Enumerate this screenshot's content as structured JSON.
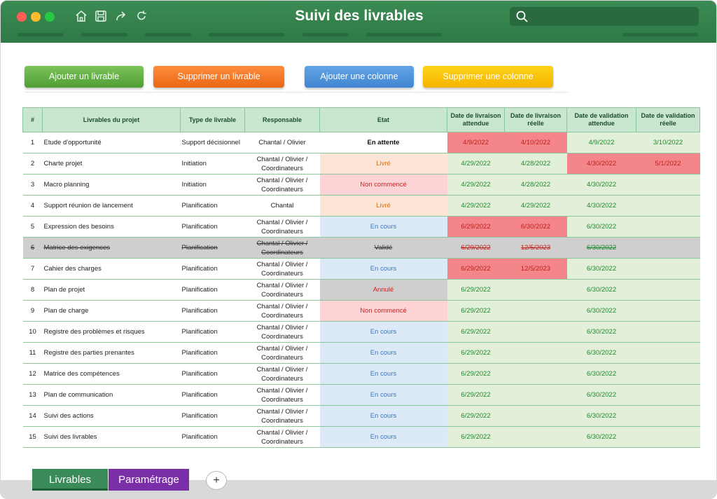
{
  "window": {
    "title": "Suivi des livrables",
    "search_placeholder": ""
  },
  "toolbar": {
    "add_label": "Ajouter un livrable",
    "delete_label": "Supprimer un livrable",
    "add_column_label": "Ajouter une colonne",
    "delete_column_label": "Supprimer une colonne"
  },
  "table": {
    "headers": [
      "#",
      "Livrables du projet",
      "Type de livrable",
      "Responsable",
      "Etat",
      "Date de livraison attendue",
      "Date de livraison réelle",
      "Date de validation attendue",
      "Date de validation réelle"
    ],
    "rows": [
      {
        "n": "1",
        "name": "Etude d'opportunité",
        "type": "Support décisionnel",
        "resp": "Chantal / Olivier",
        "state": "En attente",
        "d1": "4/9/2022",
        "d2": "4/10/2022",
        "d3": "4/9/2022",
        "d4": "3/10/2022"
      },
      {
        "n": "2",
        "name": "Charte projet",
        "type": "Initiation",
        "resp": "Chantal / Olivier / Coordinateurs",
        "state": "Livré",
        "d1": "4/29/2022",
        "d2": "4/28/2022",
        "d3": "4/30/2022",
        "d4": "5/1/2022"
      },
      {
        "n": "3",
        "name": "Macro planning",
        "type": "Initiation",
        "resp": "Chantal / Olivier / Coordinateurs",
        "state": "Non commencé",
        "d1": "4/29/2022",
        "d2": "4/28/2022",
        "d3": "4/30/2022",
        "d4": ""
      },
      {
        "n": "4",
        "name": "Support réunion de lancement",
        "type": "Planification",
        "resp": "Chantal",
        "state": "Livré",
        "d1": "4/29/2022",
        "d2": "4/29/2022",
        "d3": "4/30/2022",
        "d4": ""
      },
      {
        "n": "5",
        "name": "Expression des besoins",
        "type": "Planification",
        "resp": "Chantal / Olivier / Coordinateurs",
        "state": "En cours",
        "d1": "6/29/2022",
        "d2": "6/30/2022",
        "d3": "6/30/2022",
        "d4": ""
      },
      {
        "n": "6",
        "name": "Matrice des exigences",
        "type": "Planification",
        "resp": "Chantal / Olivier / Coordinateurs",
        "state": "Validé",
        "d1": "6/29/2022",
        "d2": "12/5/2023",
        "d3": "6/30/2022",
        "d4": ""
      },
      {
        "n": "7",
        "name": "Cahier des charges",
        "type": "Planification",
        "resp": "Chantal / Olivier / Coordinateurs",
        "state": "En cours",
        "d1": "6/29/2022",
        "d2": "12/5/2023",
        "d3": "6/30/2022",
        "d4": ""
      },
      {
        "n": "8",
        "name": "Plan de projet",
        "type": "Planification",
        "resp": "Chantal / Olivier / Coordinateurs",
        "state": "Annulé",
        "d1": "6/29/2022",
        "d2": "",
        "d3": "6/30/2022",
        "d4": ""
      },
      {
        "n": "9",
        "name": "Plan de charge",
        "type": "Planification",
        "resp": "Chantal / Olivier / Coordinateurs",
        "state": "Non commencé",
        "d1": "6/29/2022",
        "d2": "",
        "d3": "6/30/2022",
        "d4": ""
      },
      {
        "n": "10",
        "name": "Registre des problèmes et risques",
        "type": "Planification",
        "resp": "Chantal / Olivier / Coordinateurs",
        "state": "En cours",
        "d1": "6/29/2022",
        "d2": "",
        "d3": "6/30/2022",
        "d4": ""
      },
      {
        "n": "11",
        "name": "Registre des parties prenantes",
        "type": "Planification",
        "resp": "Chantal / Olivier / Coordinateurs",
        "state": "En cours",
        "d1": "6/29/2022",
        "d2": "",
        "d3": "6/30/2022",
        "d4": ""
      },
      {
        "n": "12",
        "name": "Matrice des compétences",
        "type": "Planification",
        "resp": "Chantal / Olivier / Coordinateurs",
        "state": "En cours",
        "d1": "6/29/2022",
        "d2": "",
        "d3": "6/30/2022",
        "d4": ""
      },
      {
        "n": "13",
        "name": "Plan de communication",
        "type": "Planification",
        "resp": "Chantal / Olivier / Coordinateurs",
        "state": "En cours",
        "d1": "6/29/2022",
        "d2": "",
        "d3": "6/30/2022",
        "d4": ""
      },
      {
        "n": "14",
        "name": "Suivi des actions",
        "type": "Planification",
        "resp": "Chantal / Olivier / Coordinateurs",
        "state": "En cours",
        "d1": "6/29/2022",
        "d2": "",
        "d3": "6/30/2022",
        "d4": ""
      },
      {
        "n": "15",
        "name": "Suivi des livrables",
        "type": "Planification",
        "resp": "Chantal / Olivier / Coordinateurs",
        "state": "En cours",
        "d1": "6/29/2022",
        "d2": "",
        "d3": "6/30/2022",
        "d4": ""
      }
    ]
  },
  "sheets": {
    "tab1": "Livrables",
    "tab2": "Paramétrage",
    "add": "+"
  },
  "colors": {
    "titlebar": "#2f7a47",
    "tab_livrables": "#3a8b5a",
    "tab_parametrage": "#7a2ea8"
  }
}
